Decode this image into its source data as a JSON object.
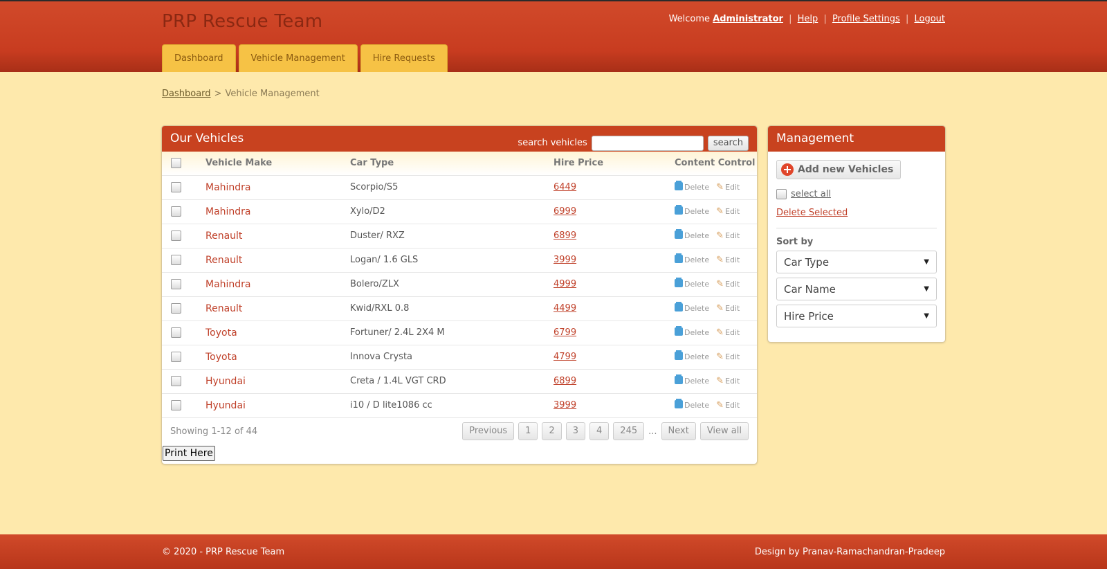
{
  "site": {
    "title": "PRP Rescue Team"
  },
  "topnav": {
    "welcome": "Welcome",
    "user": "Administrator",
    "links": [
      "Help",
      "Profile Settings",
      "Logout"
    ],
    "separator": "|"
  },
  "tabs": [
    "Dashboard",
    "Vehicle Management",
    "Hire Requests"
  ],
  "breadcrumb": {
    "home": "Dashboard",
    "arrow": ">",
    "current": "Vehicle Management"
  },
  "vehicles": {
    "title": "Our Vehicles",
    "search_label": "search vehicles",
    "search_value": "",
    "search_button": "search",
    "columns": [
      "Vehicle Make",
      "Car Type",
      "Hire Price",
      "Content Control"
    ],
    "delete_label": "Delete",
    "edit_label": "Edit",
    "rows": [
      {
        "make": "Mahindra",
        "type": "Scorpio/S5",
        "price": "6449"
      },
      {
        "make": "Mahindra",
        "type": "Xylo/D2",
        "price": "6999"
      },
      {
        "make": "Renault",
        "type": "Duster/ RXZ",
        "price": "6899"
      },
      {
        "make": "Renault",
        "type": "Logan/ 1.6 GLS",
        "price": "3999"
      },
      {
        "make": "Mahindra",
        "type": "Bolero/ZLX",
        "price": "4999"
      },
      {
        "make": "Renault",
        "type": "Kwid/RXL 0.8",
        "price": "4499"
      },
      {
        "make": "Toyota",
        "type": "Fortuner/ 2.4L 2X4 M",
        "price": "6799"
      },
      {
        "make": "Toyota",
        "type": "Innova Crysta",
        "price": "4799"
      },
      {
        "make": "Hyundai",
        "type": "Creta / 1.4L VGT CRD",
        "price": "6899"
      },
      {
        "make": "Hyundai",
        "type": "i10 / D lite1086 cc",
        "price": "3999"
      }
    ],
    "showing": "Showing 1-12 of 44",
    "pager": {
      "previous": "Previous",
      "pages": [
        "1",
        "2",
        "3",
        "4",
        "245"
      ],
      "ellipsis": "...",
      "next": "Next",
      "view_all": "View all"
    },
    "print_button": "Print Here"
  },
  "management": {
    "title": "Management",
    "add_button": "Add new Vehicles",
    "select_all": "select all",
    "delete_selected": "Delete Selected",
    "sort_label": "Sort by",
    "sort_selects": [
      "Car Type",
      "Car Name",
      "Hire Price"
    ]
  },
  "footer": {
    "copyright": "© 2020 - PRP Rescue Team",
    "design": "Design by Pranav-Ramachandran-Pradeep"
  },
  "colors": {
    "header": "#c8421f",
    "background": "#fee9ac",
    "tab": "#f6c245",
    "link": "#c0412a"
  },
  "icons": {
    "delete": "trash-icon",
    "edit": "pencil-icon",
    "add": "plus-icon",
    "select": "caret-down-icon"
  }
}
